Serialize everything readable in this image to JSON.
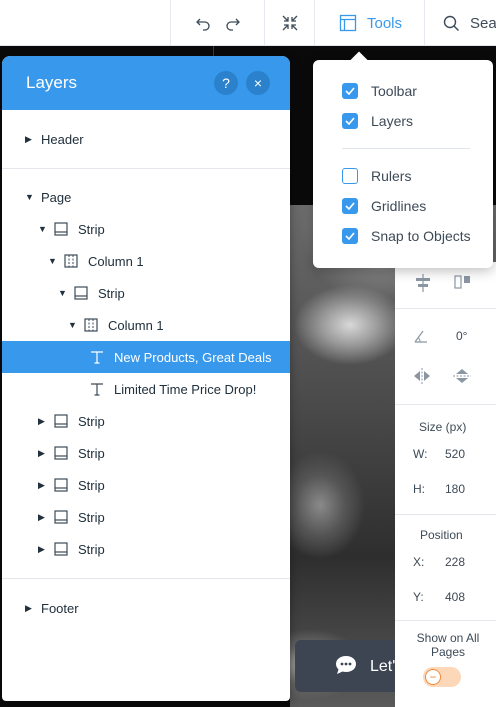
{
  "topbar": {
    "tools_label": "Tools",
    "search_label": "Sear"
  },
  "layers": {
    "title": "Layers",
    "help": "?",
    "close": "×",
    "rows": [
      {
        "label": "Header"
      },
      {
        "label": "Page"
      },
      {
        "label": "Strip"
      },
      {
        "label": "Column 1"
      },
      {
        "label": "Strip"
      },
      {
        "label": "Column 1"
      },
      {
        "label": "New Products, Great Deals"
      },
      {
        "label": "Limited Time Price Drop!"
      },
      {
        "label": "Strip"
      },
      {
        "label": "Strip"
      },
      {
        "label": "Strip"
      },
      {
        "label": "Strip"
      },
      {
        "label": "Strip"
      },
      {
        "label": "Footer"
      }
    ]
  },
  "tools_menu": {
    "items": [
      {
        "label": "Toolbar",
        "checked": true
      },
      {
        "label": "Layers",
        "checked": true
      },
      {
        "label": "Rulers",
        "checked": false
      },
      {
        "label": "Gridlines",
        "checked": true
      },
      {
        "label": "Snap to Objects",
        "checked": true
      }
    ]
  },
  "props": {
    "rotation": "0°",
    "size_label": "Size (px)",
    "w_label": "W:",
    "w_value": "520",
    "h_label": "H:",
    "h_value": "180",
    "position_label": "Position",
    "x_label": "X:",
    "x_value": "228",
    "y_label": "Y:",
    "y_value": "408",
    "show_all_label": "Show on All Pages",
    "show_all_on": false
  },
  "chat": {
    "label": "Let's Chat!"
  },
  "colors": {
    "accent": "#3899ec",
    "selected_row": "#3899ec",
    "toggle_off": "#f08a3d"
  }
}
